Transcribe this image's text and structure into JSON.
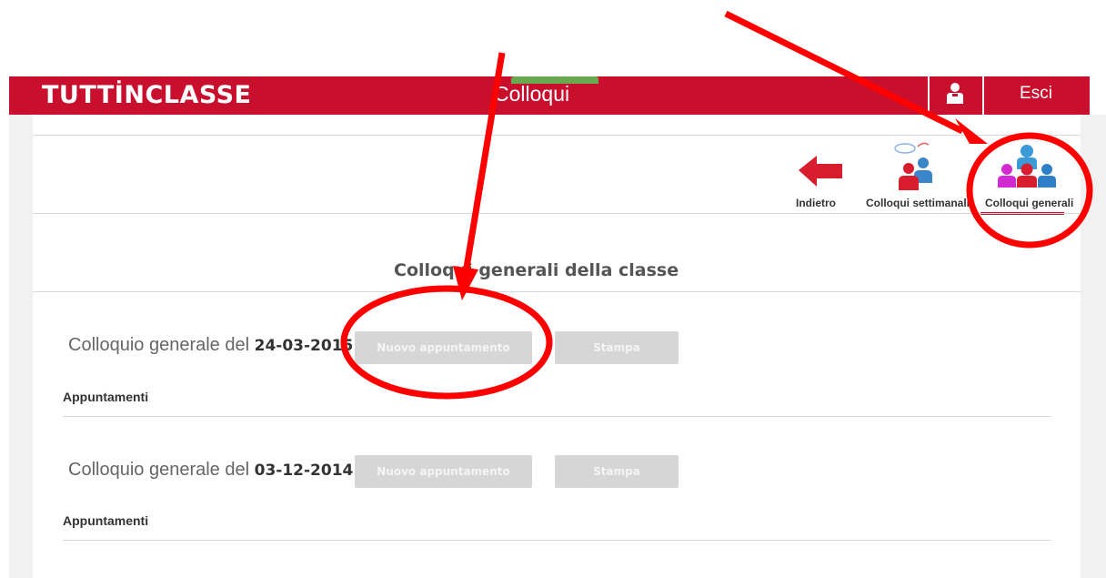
{
  "header": {
    "brand": "TUTTİNCLASSE",
    "title": "Colloqui",
    "logout_label": "Esci"
  },
  "toolbar": {
    "back_label": "Indietro",
    "weekly_label": "Colloqui settimanali",
    "general_label": "Colloqui generali"
  },
  "section": {
    "title": "Colloqui generali della classe"
  },
  "colloqui": [
    {
      "prefix": "Colloquio generale del",
      "date": "24-03-2015",
      "new_button": "Nuovo appuntamento",
      "print_button": "Stampa",
      "appointments_label": "Appuntamenti"
    },
    {
      "prefix": "Colloquio generale del",
      "date": "03-12-2014",
      "new_button": "Nuovo appuntamento",
      "print_button": "Stampa",
      "appointments_label": "Appuntamenti"
    }
  ],
  "colors": {
    "brand_red": "#c8102e",
    "annotation_red": "#ff0000",
    "disabled_button": "#d6d6d6"
  },
  "icons": [
    "user-icon",
    "back-arrow-icon",
    "weekly-meetings-icon",
    "general-meetings-icon"
  ]
}
